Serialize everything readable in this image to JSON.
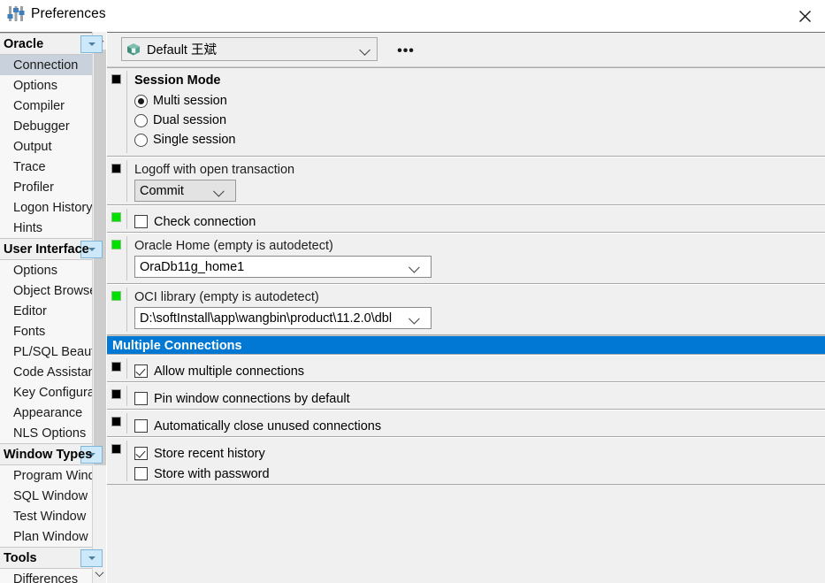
{
  "window": {
    "title": "Preferences",
    "icon": "sliders-icon",
    "close_label": "✕"
  },
  "sidebar": {
    "groups": [
      {
        "label": "Oracle",
        "items": [
          "Connection",
          "Options",
          "Compiler",
          "Debugger",
          "Output",
          "Trace",
          "Profiler",
          "Logon History",
          "Hints"
        ],
        "selected": "Connection"
      },
      {
        "label": "User Interface",
        "items": [
          "Options",
          "Object Browser",
          "Editor",
          "Fonts",
          "PL/SQL Beautifier",
          "Code Assistant",
          "Key Configuration",
          "Appearance",
          "NLS Options"
        ],
        "selected": ""
      },
      {
        "label": "Window Types",
        "items": [
          "Program Window",
          "SQL Window",
          "Test Window",
          "Plan Window"
        ],
        "selected": ""
      },
      {
        "label": "Tools",
        "items": [
          "Differences"
        ],
        "selected": ""
      }
    ]
  },
  "toolbar": {
    "profile_icon": "package-icon",
    "profile_value": "Default 王斌",
    "ellipsis_label": "•••"
  },
  "sections": {
    "session_mode": {
      "marker": "black",
      "heading": "Session Mode",
      "options": [
        {
          "label": "Multi session",
          "checked": true
        },
        {
          "label": "Dual session",
          "checked": false
        },
        {
          "label": "Single session",
          "checked": false
        }
      ]
    },
    "logoff": {
      "marker": "black",
      "label": "Logoff with open transaction",
      "value": "Commit"
    },
    "check_connection": {
      "marker": "green",
      "label": "Check connection",
      "checked": false
    },
    "oracle_home": {
      "marker": "green",
      "label": "Oracle Home (empty is autodetect)",
      "value": "OraDb11g_home1"
    },
    "oci_library": {
      "marker": "green",
      "label": "OCI library (empty is autodetect)",
      "value": "D:\\softInstall\\app\\wangbin\\product\\11.2.0\\dbl"
    },
    "multiple_connections": {
      "title": "Multiple Connections",
      "title_color": "#0078d4",
      "rows": [
        {
          "marker": "black",
          "items": [
            {
              "label": "Allow multiple connections",
              "checked": true
            }
          ]
        },
        {
          "marker": "black",
          "items": [
            {
              "label": "Pin window connections by default",
              "checked": false
            }
          ]
        },
        {
          "marker": "black",
          "items": [
            {
              "label": "Automatically close unused connections",
              "checked": false
            }
          ]
        },
        {
          "marker": "black",
          "items": [
            {
              "label": "Store recent history",
              "checked": true
            },
            {
              "label": "Store with password",
              "checked": false
            }
          ]
        }
      ]
    }
  }
}
